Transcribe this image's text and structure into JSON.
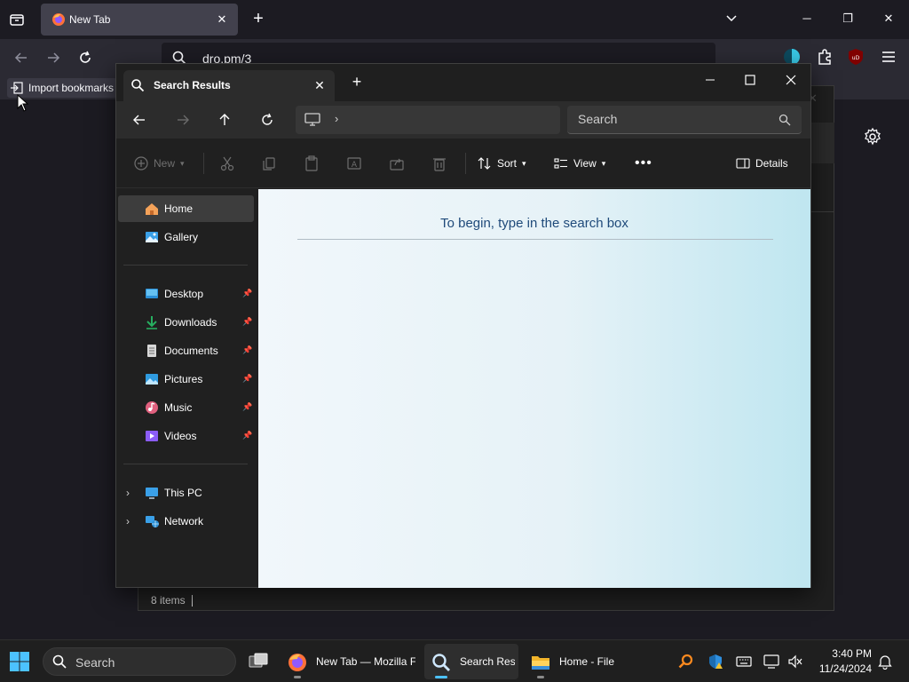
{
  "firefox": {
    "tab_title": "New Tab",
    "url_text": "dro.pm/3",
    "import_bookmarks_label": "Import bookmarks",
    "accent": "#2b2a33"
  },
  "explorer": {
    "tab_title": "Search Results",
    "search_placeholder": "Search",
    "commands": {
      "new_label": "New",
      "sort_label": "Sort",
      "view_label": "View",
      "details_label": "Details"
    },
    "sidebar": {
      "items": [
        {
          "label": "Home",
          "icon": "home-icon",
          "pinned": false,
          "selected": true
        },
        {
          "label": "Gallery",
          "icon": "gallery-icon",
          "pinned": false
        },
        {
          "label": "Desktop",
          "icon": "desktop-icon",
          "pinned": true
        },
        {
          "label": "Downloads",
          "icon": "downloads-icon",
          "pinned": true
        },
        {
          "label": "Documents",
          "icon": "documents-icon",
          "pinned": true
        },
        {
          "label": "Pictures",
          "icon": "pictures-icon",
          "pinned": true
        },
        {
          "label": "Music",
          "icon": "music-icon",
          "pinned": true
        },
        {
          "label": "Videos",
          "icon": "videos-icon",
          "pinned": true
        },
        {
          "label": "This PC",
          "icon": "this-pc-icon",
          "expandable": true
        },
        {
          "label": "Network",
          "icon": "network-icon",
          "expandable": true
        }
      ]
    },
    "empty_message": "To begin, type in the search box",
    "status_items": "8 items"
  },
  "taskbar": {
    "search_label": "Search",
    "apps": [
      {
        "label": "New Tab — Mozilla F",
        "icon": "firefox-icon"
      },
      {
        "label": "Search Resı",
        "icon": "search-results-icon",
        "active": true
      },
      {
        "label": "Home - File",
        "icon": "file-explorer-icon"
      }
    ],
    "time": "3:40 PM",
    "date": "11/24/2024"
  }
}
